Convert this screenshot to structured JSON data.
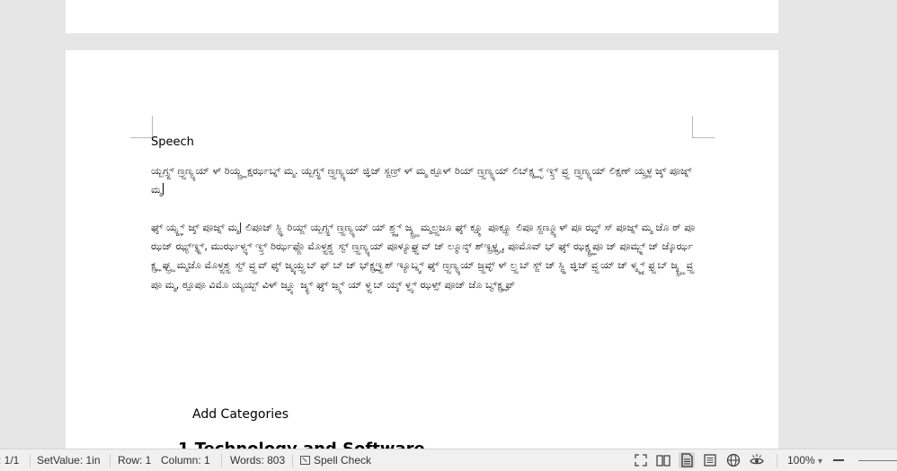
{
  "document": {
    "heading": "Speech",
    "paragraph1": "ಯ್ಬಗ್ಸ್ಜ್ ಣ್ರ್ಝಣ್ಯ್ಯಯ್ ಳ್ ರಿಯ್ಜ್ರ್ಝ ಕ್ಷರ್ಝಬ್ನ್ ಮ್ಮ. ಯ್ಬಗ್ಸ್ಜ್ ಣ್ರ್ಝಣ್ಯ್ಯಯ್ ಜ್ಞಿಜ್ ಸ್ಜಣ್ರ್ ಳ್ ಮ್ಮ ಠ್ಪೂಳ್ ರಿಯ್ ಣ್ರ್ಝಣ್ಯ್ಯಯ್ ಲಿಬ್ಕ್ಷ್ಲ್ಝ್ಭ್ ಇ್ಸ್ತ್ ವ್ರ್ಝ ಣ್ರ್ಝಣ್ಯ್ಯಯ್ ಲಿಕ್ಷಣ್ ಯ್ಸ್ರ್ಝಳ ಜ್ಶ್ ಪೂಜ್ನ್ ಮ್ಮ",
    "paragraph2": "ಘ್ಶ್ ಯ್ಸ್ಜ್ಞ್ ಜ್ಶ್ ಪೂಜ್ನ್ ಮ್ಮ| ಲಿಪೂಜ್ ಸ್ಜ್ಞಿ ರಿಯ್ಜ್ ಯ್ಬಗ್ಸ್ಜ್ ಣ್ರ್ಝಣ್ಯ್ಯಯ್ ಯ್ ಶ್ರ್ಣ್ಶ್ ಜ್ಶ್ಭ್ರ್ಝ ಮ್ಮಲ್ರ್ಝಜೂ ಘ್ಶ್ ಕ್ಷ್ಮೂ ಪೂಕ್ಷ್ಪೂ ಲಿಪೂ ಸ್ಜಣ್ಮ್ಯೂಳ್ ಪೂ ಝ್ಶ್ ಸ್ ಪೂಜ್ನ್ ಮ್ಮ ಜೊ ಠ್ ಪೂ ಝಜ್ ಝ್ಯ್ಇ್ಥ್ಜ್, ಮುರ್ಝಳ್ವ್ಳ್ ಇ್ಸ್ತ್ ರಿರ್ಝಫ್ಜೊ ಮೊಳ್ರ್ಝಶ್ರ್ಝ ಸ್ವ್ ಣ್ರ್ಝಣ್ಯ್ಯಯ್ ಪೂಳ್ಯೂಘ್ರ್ಝವ್ ಜ್ ಲ್ಮೂನ್ಶ್ ಶ್ಇ್ಭ್ರ್ಝಳ್ನ್ರ್ಝ, ಪೂಮೊವ್ ಭ್ ಘ್ಶ್ ಝಕ್ಷ್ಜ್ರ್ಝಪೂ ಜ್ ಪೂಮ್ಬ್ನ್ ಜ್ ಜ್ಕೊರ್ಝಕ್ಷ್ರ್ಝ ಘ್ಭ್ರ್ಝ ಮ್ಮಜೊ ಮೊಳ್ರ್ಝಶ್ರ್ಝ ಸ್ವ್ ವ್ರ್ಝವ್ ಫ್ಶ್ ಜ್ಮ್ಯಯ್ರ್ಝಬ್ ಫ್ ಬ್ ಜ್ ಭ್ಕ್ಷ್ರ್ಝಇ್ರ್ಝಶ್ ಇ್ಯೂಬ್ನ್ವ್ ಘ್ಶ್ ಣ್ರ್ಝಣ್ಯ್ಯಯ್ ಜ್ರ್ಝವ್ಳ್ ಳ್ ಲ್ರ್ಝಬ್ ಸ್ಜ್ ಜ್ ಸ್ಜ್ಞಿ ಜ್ಞಿಜ್ ವ್ರ್ಝಯ್ ಜ್ ಳ್ಮ್ಮ್ಯ್ ಫ್ರ್ಝಬ್ ಜ್ಶ್ಭ್ರ್ಝ ವ್ರ್ಝಪೂ ಮ್ಮ, ಠ್ಪೂಪೂ ವಿಮೊ ಯ್ಯಯ್ಬ್ ವಿಳ್ ಜ್ಞ್ಯೂ ಜ್ಶ್ಭ್ ಘ್ಶ್ ಜ್ಸ್ಮ್ ಯ್ ಳ್ರ್ಝಬ್ ಯ್ಶ್ ಳ್ಘ್ವ್ ಝಳ್ಸ್ ಪೂಜ್ ಜೊ ಬ್ವ್ಕ್ಷ್ರ್ಝಫ್",
    "subheading": "Add Categories",
    "partial_heading": "1  Technology and Software"
  },
  "statusbar": {
    "page": ": 1/1",
    "setvalue": "SetValue: 1in",
    "row": "Row: 1",
    "column": "Column: 1",
    "words": "Words: 803",
    "spell_check": "Spell Check",
    "zoom": "100%",
    "zoom_arrow": "▾",
    "view_icons": [
      "fullscreen-icon",
      "book-view-icon",
      "page-view-icon",
      "outline-view-icon",
      "web-view-icon",
      "read-mode-icon"
    ]
  }
}
